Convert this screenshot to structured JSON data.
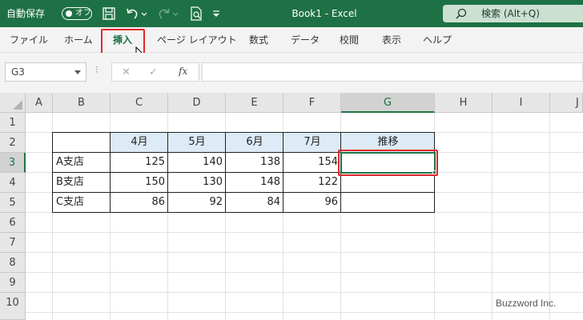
{
  "titlebar": {
    "autosave_label": "自動保存",
    "autosave_state": "オフ",
    "title": "Book1  -  Excel",
    "search_label": "検索 (Alt+Q)"
  },
  "ribbon": {
    "tabs": [
      "ファイル",
      "ホーム",
      "挿入",
      "ページ レイアウト",
      "数式",
      "データ",
      "校閲",
      "表示",
      "ヘルプ"
    ],
    "active_tab": "挿入"
  },
  "formula_bar": {
    "name_box": "G3",
    "separator": "⁝",
    "cancel_symbol": "✕",
    "enter_symbol": "✓",
    "fx_label": "fx",
    "formula": ""
  },
  "sheet": {
    "columns": [
      "A",
      "B",
      "C",
      "D",
      "E",
      "F",
      "G",
      "H",
      "I",
      "J"
    ],
    "rows": [
      "1",
      "2",
      "3",
      "4",
      "5",
      "6",
      "7",
      "8",
      "9",
      "10"
    ],
    "selected_cell": "G3",
    "header_row": [
      "",
      "4月",
      "5月",
      "6月",
      "7月",
      "推移"
    ],
    "data_rows": [
      {
        "branch": "A支店",
        "values": [
          "125",
          "140",
          "138",
          "154"
        ],
        "trend": ""
      },
      {
        "branch": "B支店",
        "values": [
          "150",
          "130",
          "148",
          "122"
        ],
        "trend": ""
      },
      {
        "branch": "C支店",
        "values": [
          "86",
          "92",
          "84",
          "96"
        ],
        "trend": ""
      }
    ],
    "header_fill": "#ddebf7",
    "selection_color": "#217346",
    "highlight_color": "#e0282e"
  },
  "watermark": "Buzzword Inc."
}
